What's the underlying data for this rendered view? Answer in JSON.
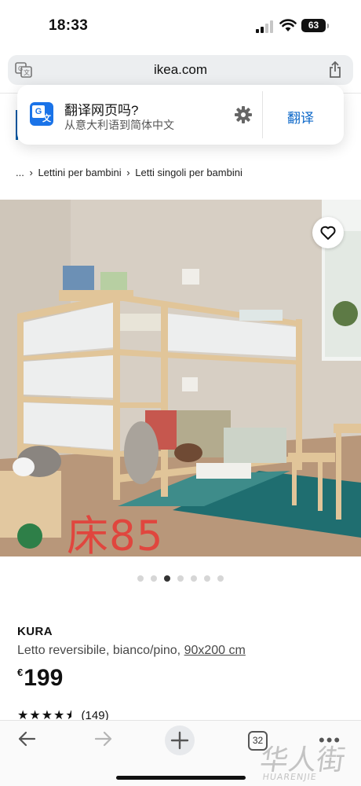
{
  "status_bar": {
    "time": "18:33",
    "battery": "63"
  },
  "browser": {
    "url": "ikea.com"
  },
  "translate_popup": {
    "title": "翻译网页吗?",
    "subtitle": "从意大利语到简体中文",
    "translate_button": "翻译"
  },
  "breadcrumb": {
    "ellipsis": "...",
    "items": [
      "Lettini per bambini",
      "Letti singoli per bambini"
    ]
  },
  "image_overlay": {
    "text": "床85"
  },
  "carousel": {
    "count": 7,
    "active_index": 2
  },
  "product": {
    "name": "KURA",
    "description": "Letto reversibile, bianco/pino,",
    "size": "90x200 cm",
    "currency": "€",
    "price": "199",
    "rating": 4.5,
    "reviews": "(149)"
  },
  "toolbar": {
    "tab_count": "32"
  },
  "watermark": {
    "text": "华人街",
    "sub": "HUARENJIE"
  },
  "colors": {
    "link_blue": "#0a66c8",
    "ikea_blue": "#0058a3",
    "overlay_red": "#e0463e"
  }
}
